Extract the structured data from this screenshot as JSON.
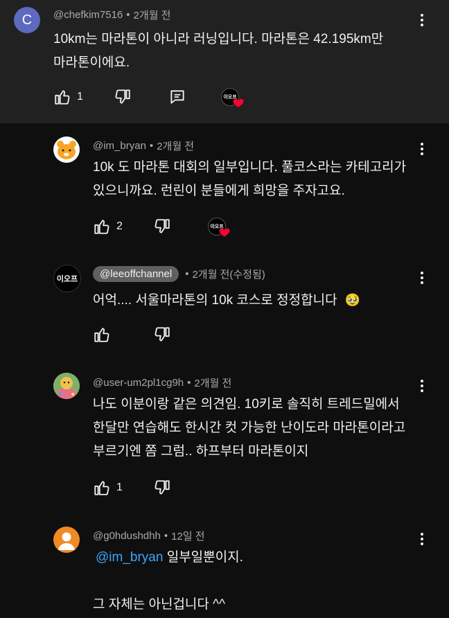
{
  "comments": [
    {
      "handle": "@chefkim7516",
      "time": "2개월 전",
      "avatar_letter": "C",
      "avatar_color": "#5c6bc0",
      "lines": [
        "10km는 마라톤이 아니라 러닝입니다. 마라톤은 42.195km만",
        "마라톤이에요."
      ],
      "likes": "1"
    },
    {
      "handle": "@im_bryan",
      "time": "2개월 전",
      "lines": [
        "10k 도 마라톤 대회의 일부입니다. 풀코스라는 카테고리가",
        "있으니까요. 런린이 분들에게 희망을 주자고요."
      ],
      "likes": "2"
    },
    {
      "handle": "@leeoffchannel",
      "time": "2개월 전(수정됨)",
      "lines": [
        "어억.... 서울마라톤의 10k 코스로 정정합니다"
      ],
      "emoji": "🥹"
    },
    {
      "handle": "@user-um2pl1cg9h",
      "time": "2개월 전",
      "lines": [
        "나도 이분이랑 같은 의견임. 10키로 솔직히 트레드밀에서",
        "한달만 연습해도 한시간 컷 가능한 난이도라 마라톤이라고",
        "부르기엔 쫌 그럼.. 하프부터 마라톤이지"
      ],
      "likes": "1"
    },
    {
      "handle": "@g0hdushdhh",
      "time": "12일 전",
      "mention": "@im_bryan",
      "line1_rest": " 일부일뿐이지.",
      "line3": "그 자체는 아닌겁니다 ^^"
    }
  ],
  "channel_logo_text": "이오프",
  "colors": {
    "accent_link": "#3ea6ff",
    "heart": "#ff0033",
    "avatar_orange": "#f08a24"
  }
}
